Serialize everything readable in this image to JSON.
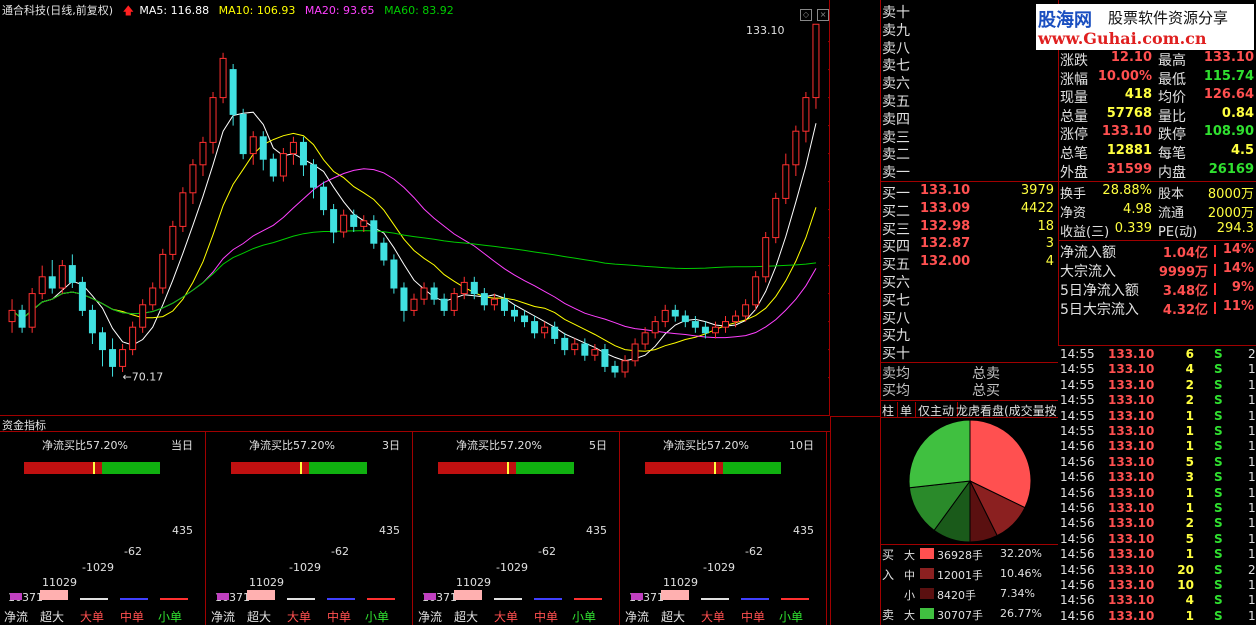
{
  "header": {
    "stock_name": "通合科技(日线,前复权)",
    "ma5": "MA5: 116.88",
    "ma10": "MA10: 106.93",
    "ma20": "MA20: 93.65",
    "ma60": "MA60: 83.92",
    "colors": {
      "ma5": "#ffffff",
      "ma10": "#ffff00",
      "ma20": "#ff40ff",
      "ma60": "#00cc00"
    }
  },
  "chart_data": {
    "type": "candlestick",
    "y_ticks": [
      "130.0",
      "125.0",
      "120.0",
      "115.0",
      "110.0",
      "105.0",
      "100.0",
      "95.0",
      "90.0",
      "85.0",
      "80.0",
      "75.0",
      "70.0"
    ],
    "ylim": [
      66,
      133.5
    ],
    "high_label": "133.10",
    "low_label": "70.17",
    "candles": [
      [
        80,
        82,
        78,
        84
      ],
      [
        82,
        79,
        78,
        83
      ],
      [
        79,
        85,
        78,
        86
      ],
      [
        85,
        88,
        84,
        90
      ],
      [
        88,
        86,
        85,
        91
      ],
      [
        86,
        90,
        85,
        91
      ],
      [
        90,
        87,
        86,
        92
      ],
      [
        87,
        82,
        81,
        88
      ],
      [
        82,
        78,
        76,
        83
      ],
      [
        78,
        75,
        72,
        79
      ],
      [
        75,
        72,
        70.17,
        77
      ],
      [
        72,
        75,
        71,
        76
      ],
      [
        75,
        79,
        74,
        80
      ],
      [
        79,
        83,
        78,
        84
      ],
      [
        83,
        86,
        82,
        87
      ],
      [
        86,
        92,
        85,
        93
      ],
      [
        92,
        97,
        91,
        98
      ],
      [
        97,
        103,
        96,
        104
      ],
      [
        103,
        108,
        101,
        109
      ],
      [
        108,
        112,
        106,
        113
      ],
      [
        112,
        120,
        110,
        121
      ],
      [
        120,
        127,
        119,
        128
      ],
      [
        125,
        117,
        115,
        126
      ],
      [
        117,
        110,
        109,
        118
      ],
      [
        110,
        113,
        108,
        114
      ],
      [
        113,
        109,
        107,
        114
      ],
      [
        109,
        106,
        105,
        110
      ],
      [
        106,
        110,
        105,
        111
      ],
      [
        110,
        112,
        108,
        113
      ],
      [
        112,
        108,
        106,
        113
      ],
      [
        108,
        104,
        102,
        109
      ],
      [
        104,
        100,
        99,
        105
      ],
      [
        100,
        96,
        94,
        101
      ],
      [
        96,
        99,
        95,
        100
      ],
      [
        99,
        97,
        96,
        100
      ],
      [
        97,
        98,
        96,
        99
      ],
      [
        98,
        94,
        93,
        99
      ],
      [
        94,
        91,
        90,
        95
      ],
      [
        91,
        86,
        85,
        92
      ],
      [
        86,
        82,
        80,
        87
      ],
      [
        82,
        84,
        81,
        85
      ],
      [
        84,
        86,
        83,
        87
      ],
      [
        86,
        84,
        83,
        87
      ],
      [
        84,
        82,
        81,
        85
      ],
      [
        82,
        85,
        81,
        86
      ],
      [
        85,
        87,
        84,
        88
      ],
      [
        87,
        85,
        84,
        88
      ],
      [
        85,
        83,
        82,
        86
      ],
      [
        83,
        84,
        82,
        85
      ],
      [
        84,
        82,
        81,
        85
      ],
      [
        82,
        81,
        80,
        83
      ],
      [
        81,
        80,
        79,
        82
      ],
      [
        80,
        78,
        77,
        81
      ],
      [
        78,
        79,
        77,
        80
      ],
      [
        79,
        77,
        76,
        80
      ],
      [
        77,
        75,
        74,
        78
      ],
      [
        75,
        76,
        74,
        77
      ],
      [
        76,
        74,
        73,
        77
      ],
      [
        74,
        75,
        73,
        76
      ],
      [
        75,
        72,
        71,
        76
      ],
      [
        72,
        71,
        70,
        73
      ],
      [
        71,
        73,
        70,
        74
      ],
      [
        73,
        76,
        72,
        77
      ],
      [
        76,
        78,
        75,
        79
      ],
      [
        78,
        80,
        77,
        81
      ],
      [
        80,
        82,
        79,
        83
      ],
      [
        82,
        81,
        80,
        83
      ],
      [
        81,
        80,
        79,
        82
      ],
      [
        80,
        79,
        78,
        81
      ],
      [
        79,
        78,
        77,
        80
      ],
      [
        78,
        79,
        77,
        80
      ],
      [
        79,
        80,
        78,
        81
      ],
      [
        80,
        81,
        79,
        82
      ],
      [
        81,
        83,
        80,
        84
      ],
      [
        83,
        88,
        82,
        89
      ],
      [
        88,
        95,
        87,
        96
      ],
      [
        95,
        102,
        94,
        103
      ],
      [
        102,
        108,
        101,
        110
      ],
      [
        108,
        114,
        106,
        115
      ],
      [
        114,
        120,
        112,
        121
      ],
      [
        120,
        133.1,
        118,
        133.1
      ]
    ]
  },
  "funds_title": "资金指标",
  "funds": [
    {
      "title": "净流买比57.20%",
      "period": "当日"
    },
    {
      "title": "净流买比57.20%",
      "period": "3日"
    },
    {
      "title": "净流买比57.20%",
      "period": "5日"
    },
    {
      "title": "净流买比57.20%",
      "period": "10日"
    }
  ],
  "funds_values": [
    "435",
    "-62",
    "-1029",
    "11029",
    "10371"
  ],
  "funds_labels": [
    "净流",
    "超大",
    "大单",
    "中单",
    "小单"
  ],
  "logo": {
    "name": "股海网",
    "slogan": "股票软件资源分享",
    "url": "www.Guhai.com.cn"
  },
  "sell_levels": [
    "卖十",
    "卖九",
    "卖八",
    "卖七",
    "卖六",
    "卖五",
    "卖四",
    "卖三",
    "卖二",
    "卖一"
  ],
  "buy_levels": [
    {
      "label": "买一",
      "price": "133.10",
      "vol": "3979"
    },
    {
      "label": "买二",
      "price": "133.09",
      "vol": "4422"
    },
    {
      "label": "买三",
      "price": "132.98",
      "vol": "18"
    },
    {
      "label": "买四",
      "price": "132.87",
      "vol": "3"
    },
    {
      "label": "买五",
      "price": "132.00",
      "vol": "4"
    },
    {
      "label": "买六",
      "price": "",
      "vol": ""
    },
    {
      "label": "买七",
      "price": "",
      "vol": ""
    },
    {
      "label": "买八",
      "price": "",
      "vol": ""
    },
    {
      "label": "买九",
      "price": "",
      "vol": ""
    },
    {
      "label": "买十",
      "price": "",
      "vol": ""
    }
  ],
  "avg": {
    "sell_avg": "卖均",
    "buy_avg": "买均",
    "total_sell": "总卖",
    "total_buy": "总买"
  },
  "stats": [
    [
      "涨跌",
      "12.10",
      "最高",
      "133.10"
    ],
    [
      "涨幅",
      "10.00%",
      "最低",
      "115.74"
    ],
    [
      "现量",
      "418",
      "均价",
      "126.64"
    ],
    [
      "总量",
      "57768",
      "量比",
      "0.84"
    ],
    [
      "涨停",
      "133.10",
      "跌停",
      "108.90"
    ],
    [
      "总笔",
      "12881",
      "每笔",
      "4.5"
    ],
    [
      "外盘",
      "31599",
      "内盘",
      "26169"
    ]
  ],
  "stats2": [
    [
      "换手",
      "28.88%",
      "股本",
      "8000万"
    ],
    [
      "净资",
      "4.98",
      "流通",
      "2000万"
    ],
    [
      "收益(三)",
      "0.339",
      "PE(动)",
      "294.3"
    ]
  ],
  "flows": [
    [
      "净流入额",
      "1.04亿",
      "14%"
    ],
    [
      "大宗流入",
      "9999万",
      "14%"
    ],
    [
      "5日净流入额",
      "3.48亿",
      "9%"
    ],
    [
      "5日大宗流入",
      "4.32亿",
      "11%"
    ]
  ],
  "tabs": [
    "柱",
    "单",
    "仅主动",
    "龙虎看盘(成交量按"
  ],
  "pie": [
    {
      "label": "buy-super",
      "value": 32.2,
      "color": "#ff5050"
    },
    {
      "label": "buy-big",
      "value": 10.46,
      "color": "#8b2020"
    },
    {
      "label": "buy-mid",
      "value": 7.34,
      "color": "#5a1010"
    },
    {
      "label": "sell-small",
      "value": 10.0,
      "color": "#1a5a1a"
    },
    {
      "label": "sell-mid",
      "value": 13.23,
      "color": "#2a8a2a"
    },
    {
      "label": "sell-big",
      "value": 26.77,
      "color": "#40c040"
    }
  ],
  "legend_rows": [
    {
      "side": "买",
      "size": "大",
      "qty": "36928手",
      "pct": "32.20%",
      "color": "#ff5050"
    },
    {
      "side": "入",
      "size": "中",
      "qty": "12001手",
      "pct": "10.46%",
      "color": "#8b2020"
    },
    {
      "side": "",
      "size": "小",
      "qty": "8420手",
      "pct": "7.34%",
      "color": "#5a1010"
    },
    {
      "side": "卖",
      "size": "大",
      "qty": "30707手",
      "pct": "26.77%",
      "color": "#40c040"
    }
  ],
  "ticks": [
    [
      "14:55",
      "133.10",
      "6",
      "S",
      "2"
    ],
    [
      "14:55",
      "133.10",
      "4",
      "S",
      "1"
    ],
    [
      "14:55",
      "133.10",
      "2",
      "S",
      "1"
    ],
    [
      "14:55",
      "133.10",
      "2",
      "S",
      "1"
    ],
    [
      "14:55",
      "133.10",
      "1",
      "S",
      "1"
    ],
    [
      "14:55",
      "133.10",
      "1",
      "S",
      "1"
    ],
    [
      "14:56",
      "133.10",
      "1",
      "S",
      "1"
    ],
    [
      "14:56",
      "133.10",
      "5",
      "S",
      "1"
    ],
    [
      "14:56",
      "133.10",
      "3",
      "S",
      "1"
    ],
    [
      "14:56",
      "133.10",
      "1",
      "S",
      "1"
    ],
    [
      "14:56",
      "133.10",
      "1",
      "S",
      "1"
    ],
    [
      "14:56",
      "133.10",
      "2",
      "S",
      "1"
    ],
    [
      "14:56",
      "133.10",
      "5",
      "S",
      "1"
    ],
    [
      "14:56",
      "133.10",
      "1",
      "S",
      "1"
    ],
    [
      "14:56",
      "133.10",
      "20",
      "S",
      "2"
    ],
    [
      "14:56",
      "133.10",
      "10",
      "S",
      "1"
    ],
    [
      "14:56",
      "133.10",
      "4",
      "S",
      "1"
    ],
    [
      "14:56",
      "133.10",
      "1",
      "S",
      "1"
    ]
  ]
}
